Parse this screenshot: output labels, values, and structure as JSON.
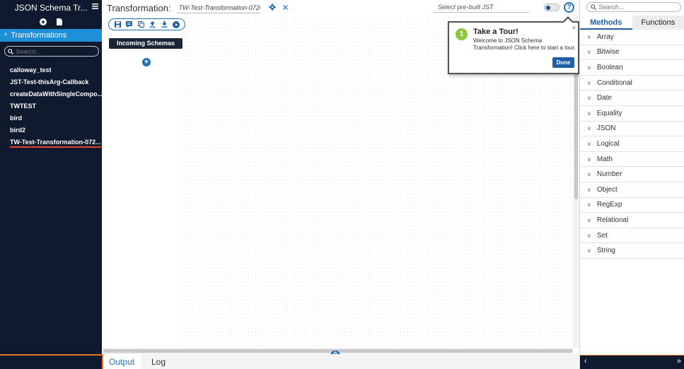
{
  "app": {
    "title": "JSON Schema Tr..."
  },
  "sidebar": {
    "section_label": "Transformations",
    "search_placeholder": "Search...",
    "items": [
      {
        "label": "calloway_test",
        "active": false
      },
      {
        "label": "JST-Test-thisArg-Callback",
        "active": false
      },
      {
        "label": "createDataWithSingleCompo...",
        "active": false
      },
      {
        "label": "TWTEST",
        "active": false
      },
      {
        "label": "bird",
        "active": false
      },
      {
        "label": "bird2",
        "active": false
      },
      {
        "label": "TW-Test-Transformation-072...",
        "active": true
      }
    ]
  },
  "header": {
    "label": "Transformation:",
    "transformation_name": "TW-Test-Transformation-0720...",
    "prebuilt_placeholder": "Select pre-built JST",
    "help_symbol": "?"
  },
  "canvas": {
    "incoming_schemas_label": "Incoming Schemas",
    "add_symbol": "+"
  },
  "bottom_tabs": [
    {
      "label": "Output",
      "active": true
    },
    {
      "label": "Log",
      "active": false
    }
  ],
  "tour": {
    "step": "1",
    "title": "Take a Tour!",
    "body": "Welcome to JSON Schema Transformation! Click here to start a tour.",
    "done_label": "Done",
    "close_symbol": "×"
  },
  "right_panel": {
    "search_placeholder": "Search...",
    "tabs": [
      {
        "label": "Methods",
        "active": true
      },
      {
        "label": "Functions",
        "active": false
      }
    ],
    "methods": [
      "Array",
      "Bitwise",
      "Boolean",
      "Conditional",
      "Date",
      "Equality",
      "JSON",
      "Logical",
      "Math",
      "Number",
      "Object",
      "RegExp",
      "Relational",
      "Set",
      "String"
    ],
    "footer_left": "‹",
    "footer_right": "»"
  }
}
